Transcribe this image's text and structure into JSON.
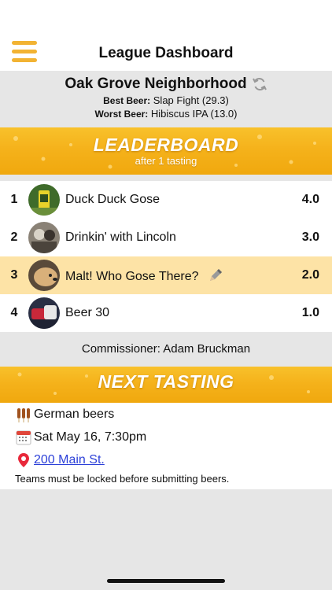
{
  "header": {
    "title": "League Dashboard",
    "menu_icon": "hamburger-icon",
    "accent": "#f2b333"
  },
  "league": {
    "name": "Oak Grove Neighborhood",
    "best_label": "Best Beer:",
    "best_value": "Slap Fight (29.3)",
    "worst_label": "Worst Beer:",
    "worst_value": "Hibiscus IPA (13.0)"
  },
  "leaderboard": {
    "title": "LEADERBOARD",
    "subtitle": "after 1 tasting",
    "teams": [
      {
        "rank": "1",
        "name": "Duck Duck Gose",
        "score": "4.0",
        "highlight": false
      },
      {
        "rank": "2",
        "name": "Drinkin' with Lincoln",
        "score": "3.0",
        "highlight": false
      },
      {
        "rank": "3",
        "name": "Malt! Who Gose There?",
        "score": "2.0",
        "highlight": true
      },
      {
        "rank": "4",
        "name": "Beer 30",
        "score": "1.0",
        "highlight": false
      }
    ]
  },
  "commissioner": "Commissioner: Adam Bruckman",
  "next_tasting": {
    "title": "NEXT TASTING",
    "theme": "German beers",
    "date": "Sat May 16, 7:30pm",
    "location": "200 Main St.",
    "note": "Teams must be locked before submitting beers."
  },
  "colors": {
    "banner": "#f5b21b",
    "highlight_row": "#fde3a6",
    "link": "#2b3fd8"
  }
}
